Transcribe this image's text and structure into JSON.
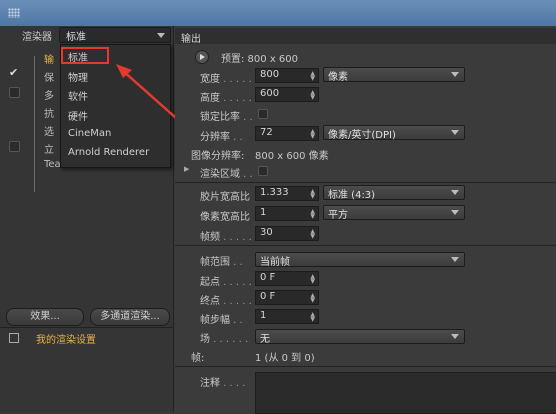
{
  "left": {
    "renderer_label": "渲染器",
    "renderer_value": "标准",
    "tree_items": [
      {
        "label": "输",
        "highlight": true,
        "checked": false,
        "has_box": false
      },
      {
        "label": "保",
        "highlight": false,
        "checked": true,
        "has_box": false
      },
      {
        "label": "多",
        "highlight": false,
        "checked": false,
        "has_box": true
      },
      {
        "label": "抗",
        "highlight": false,
        "checked": false,
        "has_box": false
      },
      {
        "label": "选",
        "highlight": false,
        "checked": false,
        "has_box": false
      },
      {
        "label": "立",
        "highlight": false,
        "checked": false,
        "has_box": true
      },
      {
        "label": "Tea",
        "highlight": false,
        "checked": false,
        "has_box": false
      }
    ],
    "dropdown_items": [
      "标准",
      "物理",
      "软件",
      "硬件",
      "CineMan",
      "Arnold Renderer"
    ],
    "effects_button": "效果...",
    "multipass_button": "多通道渲染...",
    "preset_name": "我的渲染设置"
  },
  "right": {
    "section_title": "输出",
    "preset_text": "预置: 800 x 600",
    "width_label": "宽度",
    "width_value": "800",
    "width_unit": "像素",
    "height_label": "高度",
    "height_value": "600",
    "lock_ratio_label": "锁定比率",
    "resolution_label": "分辨率",
    "resolution_value": "72",
    "resolution_unit": "像素/英寸(DPI)",
    "image_res_label": "图像分辨率:",
    "image_res_value": "800 x 600 像素",
    "render_region_label": "渲染区域",
    "film_aspect_label": "胶片宽高比",
    "film_aspect_value": "1.333",
    "film_aspect_preset": "标准 (4:3)",
    "pixel_aspect_label": "像素宽高比",
    "pixel_aspect_value": "1",
    "pixel_aspect_preset": "平方",
    "fps_label": "帧频",
    "fps_value": "30",
    "frame_range_label": "帧范围",
    "frame_range_value": "当前帧",
    "start_label": "起点",
    "start_value": "0 F",
    "end_label": "终点",
    "end_value": "0 F",
    "step_label": "帧步幅",
    "step_value": "1",
    "field_label": "场",
    "field_value": "无",
    "frames_label": "帧:",
    "frames_value": "1 (从 0 到 0)",
    "notes_label": "注释"
  },
  "colors": {
    "highlight": "#e6b24a",
    "annotation_red": "#e23b2e"
  }
}
